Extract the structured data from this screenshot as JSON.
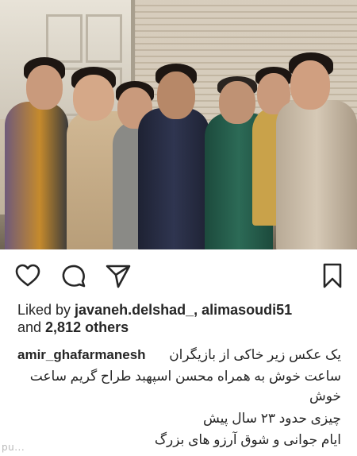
{
  "post": {
    "likes_prefix": "Liked by ",
    "liked_by_1": "javaneh.delshad_",
    "separator": ", ",
    "liked_by_2": "alimasoudi51",
    "and_text": "and ",
    "others_count": "2,812 others",
    "username": "amir_ghafarmanesh",
    "caption_line1": "یک عکس زیر خاکی از بازیگران",
    "caption_line2": "ساعت خوش به همراه محسن اسپهبد طراح گریم ساعت",
    "caption_line3": "خوش",
    "caption_line4": "چیزی حدود ۲۳ سال پیش",
    "caption_line5": "ایام جوانی و شوق آرزو های بزرگ"
  },
  "icons": {
    "like": "heart-icon",
    "comment": "comment-icon",
    "share": "send-icon",
    "save": "bookmark-icon"
  },
  "watermark": "pu...",
  "colors": {
    "text": "#262626",
    "background": "#ffffff"
  }
}
